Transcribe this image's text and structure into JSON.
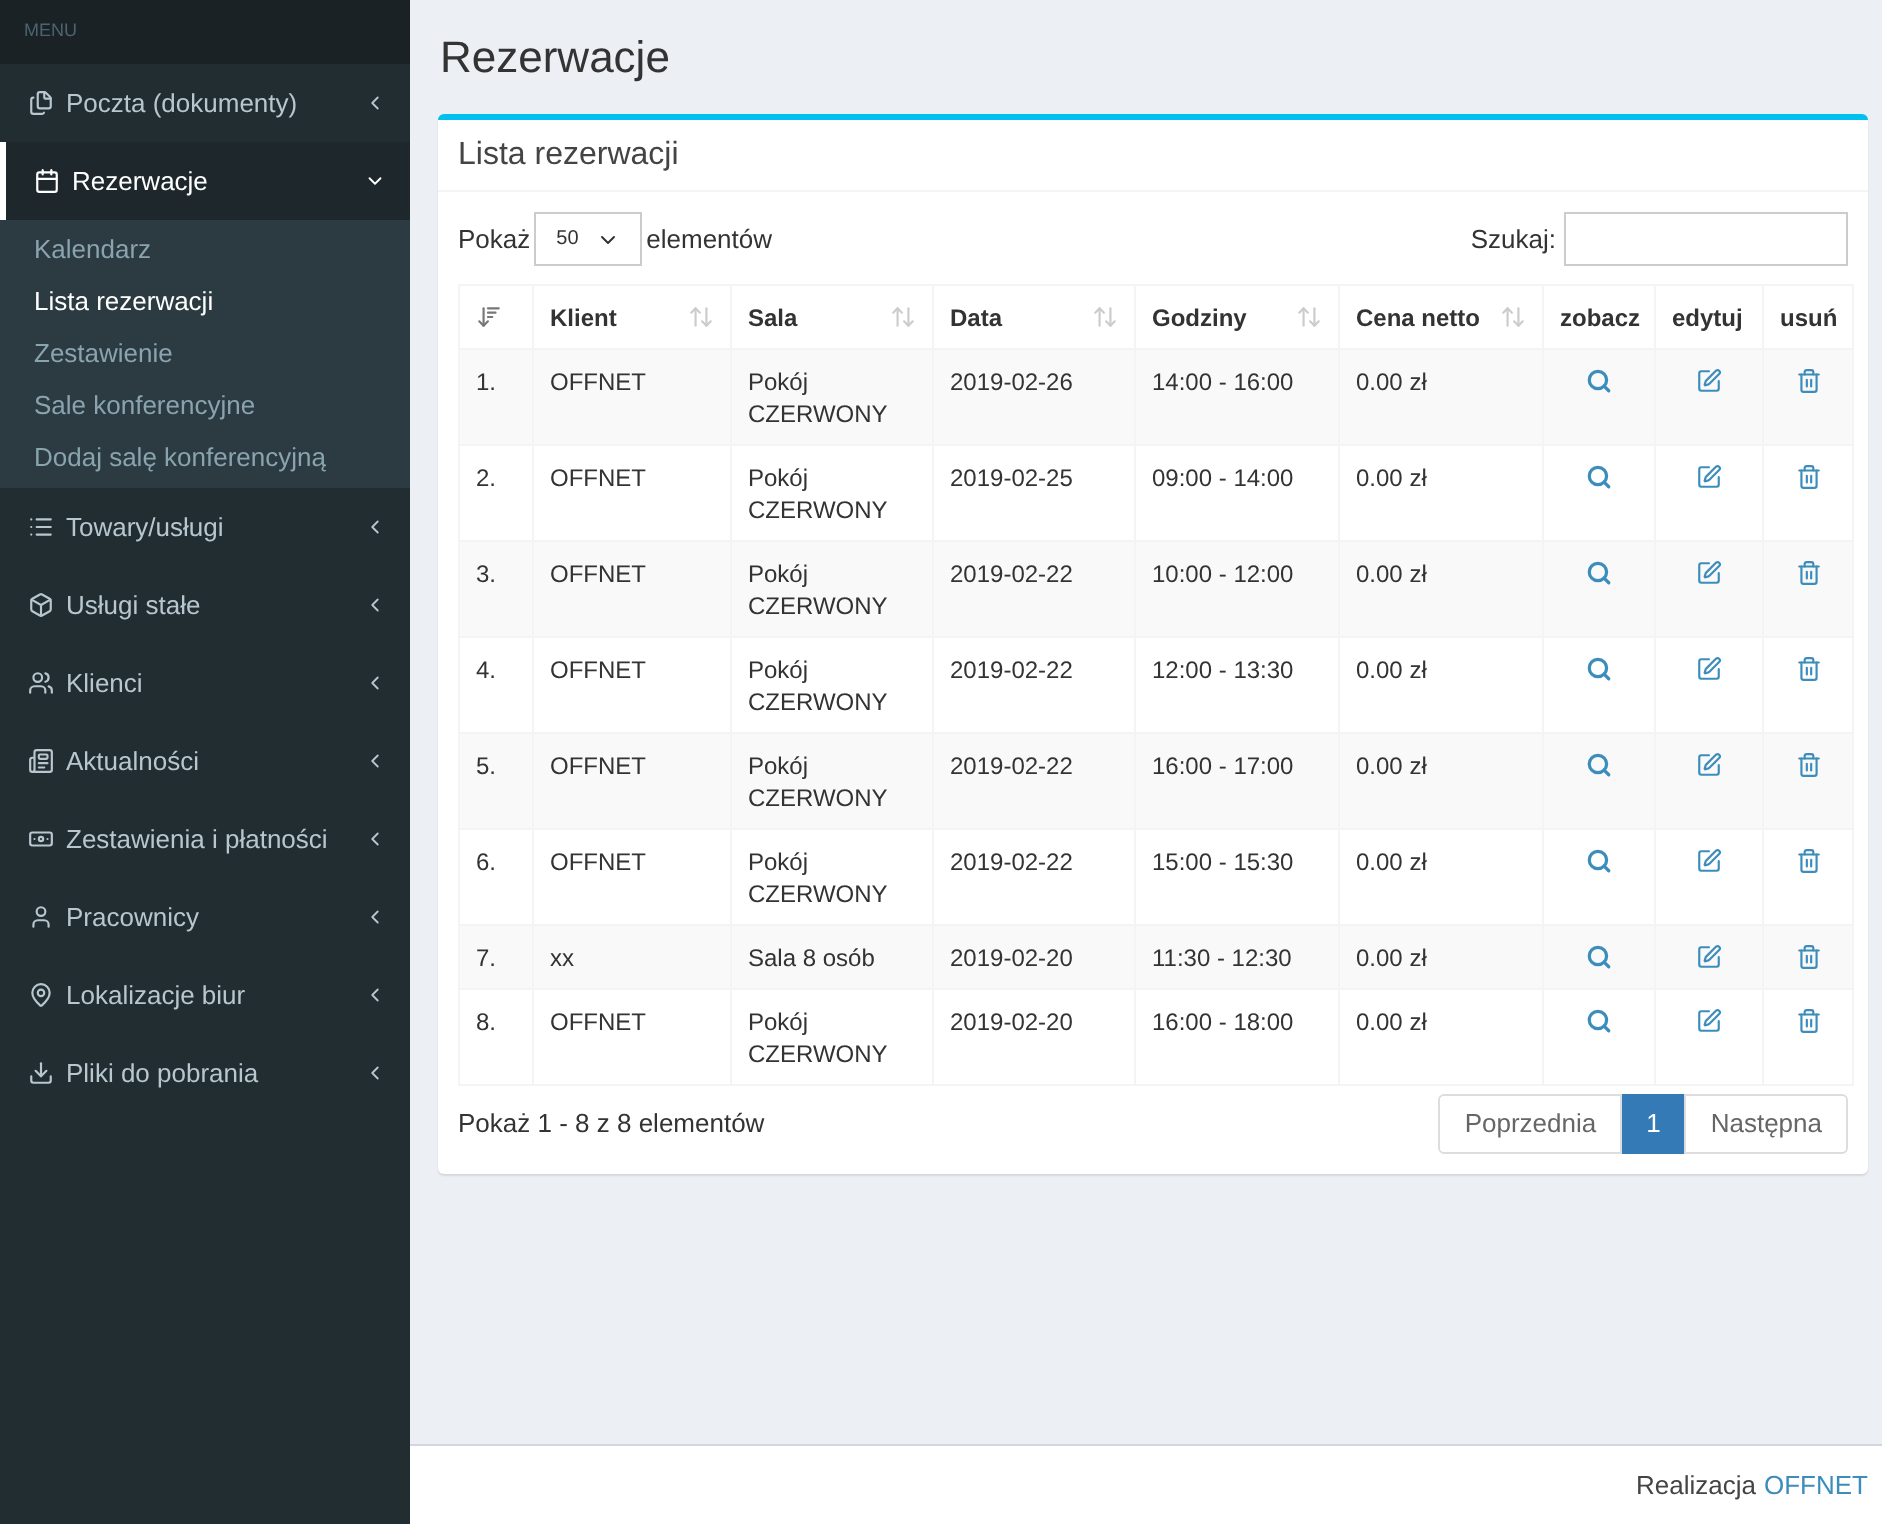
{
  "sidebar": {
    "header": "MENU",
    "items": [
      {
        "label": "Poczta (dokumenty)",
        "selected": false,
        "expanded": false
      },
      {
        "label": "Rezerwacje",
        "selected": true,
        "expanded": true,
        "children": [
          {
            "label": "Kalendarz",
            "selected": false
          },
          {
            "label": "Lista rezerwacji",
            "selected": true
          },
          {
            "label": "Zestawienie",
            "selected": false
          },
          {
            "label": "Sale konferencyjne",
            "selected": false
          },
          {
            "label": "Dodaj salę konferencyjną",
            "selected": false
          }
        ]
      },
      {
        "label": "Towary/usługi",
        "selected": false,
        "expanded": false
      },
      {
        "label": "Usługi stałe",
        "selected": false,
        "expanded": false
      },
      {
        "label": "Klienci",
        "selected": false,
        "expanded": false
      },
      {
        "label": "Aktualności",
        "selected": false,
        "expanded": false
      },
      {
        "label": "Zestawienia i płatności",
        "selected": false,
        "expanded": false
      },
      {
        "label": "Pracownicy",
        "selected": false,
        "expanded": false
      },
      {
        "label": "Lokalizacje biur",
        "selected": false,
        "expanded": false
      },
      {
        "label": "Pliki do pobrania",
        "selected": false,
        "expanded": false
      }
    ]
  },
  "page_title": "Rezerwacje",
  "box": {
    "title": "Lista rezerwacji",
    "length": {
      "before": "Pokaż",
      "value": "50",
      "after": "elementów"
    },
    "search": {
      "label": "Szukaj:"
    },
    "table": {
      "columns": [
        {
          "sorted": true
        },
        {
          "label": "Klient",
          "sorted": false
        },
        {
          "label": "Sala",
          "sorted": false
        },
        {
          "label": "Data",
          "sorted": false
        },
        {
          "label": "Godziny",
          "sorted": false
        },
        {
          "label": "Cena netto",
          "sorted": false
        },
        {
          "label": "zobacz"
        },
        {
          "label": "edytuj"
        },
        {
          "label": "usuń"
        }
      ],
      "rows": [
        [
          "1.",
          "OFFNET",
          "Pokój CZERWONY",
          "2019-02-26",
          "14:00 - 16:00",
          "0.00 zł"
        ],
        [
          "2.",
          "OFFNET",
          "Pokój CZERWONY",
          "2019-02-25",
          "09:00 - 14:00",
          "0.00 zł"
        ],
        [
          "3.",
          "OFFNET",
          "Pokój CZERWONY",
          "2019-02-22",
          "10:00 - 12:00",
          "0.00 zł"
        ],
        [
          "4.",
          "OFFNET",
          "Pokój CZERWONY",
          "2019-02-22",
          "12:00 - 13:30",
          "0.00 zł"
        ],
        [
          "5.",
          "OFFNET",
          "Pokój CZERWONY",
          "2019-02-22",
          "16:00 - 17:00",
          "0.00 zł"
        ],
        [
          "6.",
          "OFFNET",
          "Pokój CZERWONY",
          "2019-02-22",
          "15:00 - 15:30",
          "0.00 zł"
        ],
        [
          "7.",
          "xx",
          "Sala 8 osób",
          "2019-02-20",
          "11:30 - 12:30",
          "0.00 zł"
        ],
        [
          "8.",
          "OFFNET",
          "Pokój CZERWONY",
          "2019-02-20",
          "16:00 - 18:00",
          "0.00 zł"
        ]
      ]
    },
    "info": "Pokaż 1 - 8 z 8 elementów",
    "pagination": {
      "previous": "Poprzednia",
      "pages": [
        {
          "label": "1",
          "selected": true
        }
      ],
      "next": "Następna"
    }
  },
  "footer": {
    "text": "Realizacja",
    "link": "OFFNET"
  }
}
